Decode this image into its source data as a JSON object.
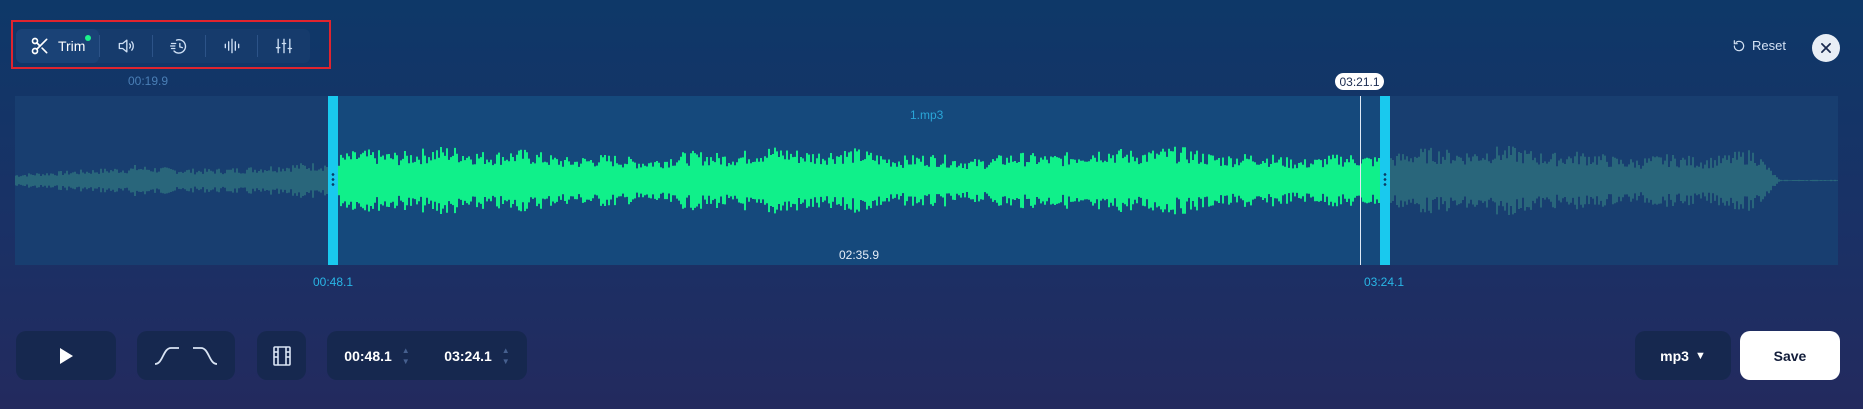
{
  "toolbar": {
    "trim_label": "Trim",
    "tools": [
      {
        "name": "trim",
        "icon": "scissors-icon",
        "active": true
      },
      {
        "name": "volume",
        "icon": "speaker-icon"
      },
      {
        "name": "speed",
        "icon": "speed-icon"
      },
      {
        "name": "equalizer",
        "icon": "waveform-icon"
      },
      {
        "name": "mixer",
        "icon": "sliders-icon"
      }
    ]
  },
  "header": {
    "reset_label": "Reset"
  },
  "timeline": {
    "hover_time": "00:19.9",
    "file_name": "1.mp3",
    "playhead_time": "03:21.1",
    "selection_length": "02:35.9",
    "selection_start": "00:48.1",
    "selection_end": "03:24.1"
  },
  "controls": {
    "start_value": "00:48.1",
    "end_value": "03:24.1",
    "format": "mp3",
    "save_label": "Save"
  },
  "colors": {
    "accent": "#19c9ee",
    "wave_selected": "#10f08a",
    "wave_unselected": "#2b6b7d",
    "background": "#1a3166"
  }
}
